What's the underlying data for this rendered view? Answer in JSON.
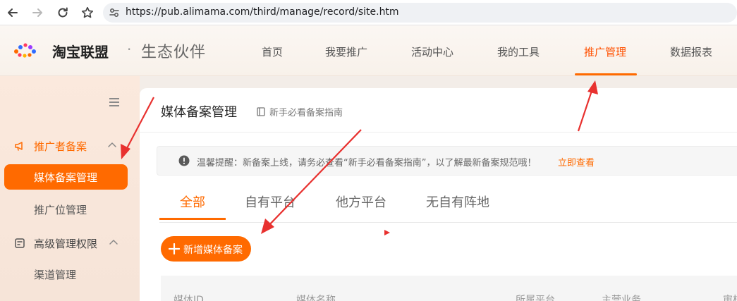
{
  "browser": {
    "url": "https://pub.alimama.com/third/manage/record/site.htm",
    "icons": [
      "back-icon",
      "forward-icon",
      "reload-icon",
      "bookmark-star-icon",
      "site-info-icon"
    ]
  },
  "header": {
    "logo_text": "淘宝联盟",
    "logo_dot": "·",
    "logo_sub": "生态伙伴",
    "nav": [
      "首页",
      "我要推广",
      "活动中心",
      "我的工具",
      "推广管理",
      "数据报表"
    ],
    "active_nav": "推广管理"
  },
  "sidebar": {
    "groups": [
      {
        "label": "推广者备案",
        "icon": "megaphone-icon",
        "active": true,
        "items": [
          {
            "label": "媒体备案管理",
            "active": true
          },
          {
            "label": "推广位管理",
            "active": false
          }
        ]
      },
      {
        "label": "高级管理权限",
        "icon": "permission-icon",
        "active": false,
        "items": [
          {
            "label": "渠道管理",
            "active": false
          }
        ]
      }
    ]
  },
  "main": {
    "title": "媒体备案管理",
    "guide_link": "新手必看备案指南",
    "notice": {
      "text": "温馨提醒：新备案上线，请务必查看“新手必看备案指南”，以了解最新备案规范哦！",
      "link": "立即查看"
    },
    "tabs": [
      "全部",
      "自有平台",
      "他方平台",
      "无自有阵地"
    ],
    "active_tab": "全部",
    "add_button": "新增媒体备案",
    "table_headers": [
      "媒体ID",
      "媒体名称",
      "所属平台",
      "主营业务",
      "审核"
    ]
  },
  "colors": {
    "accent": "#ff6a00",
    "annotation_arrow": "#e8312f"
  }
}
